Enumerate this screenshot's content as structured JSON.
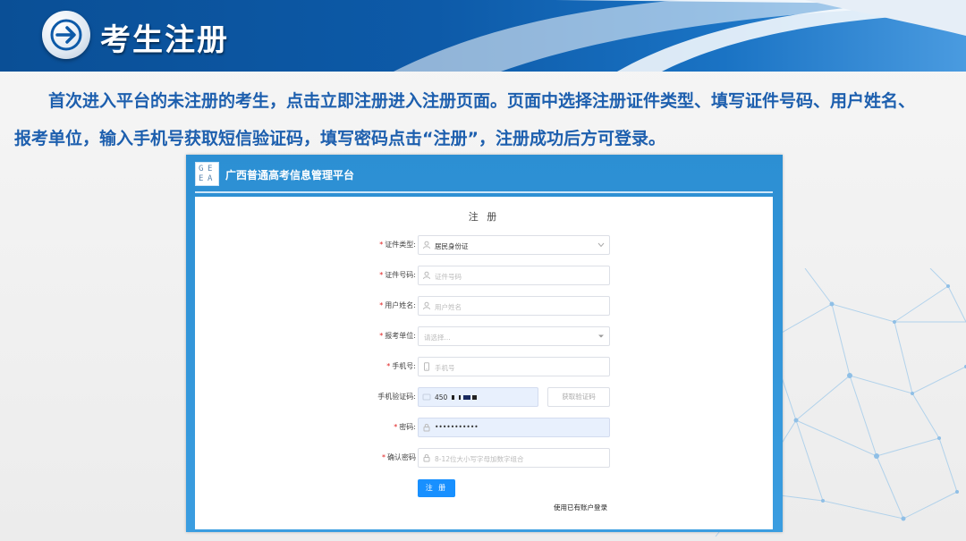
{
  "banner": {
    "title": "考生注册",
    "icon": "arrow-right-icon"
  },
  "intro": {
    "line1": "首次进入平台的未注册的考生，点击立即注册进入注册页面。页面中选择注册证件类型、填写证件号码、用户姓名、",
    "line2": "报考单位，输入手机号获取短信验证码，填写密码点击“注册”，注册成功后方可登录。"
  },
  "app": {
    "logo_letters": [
      "G",
      "E",
      "E",
      "A"
    ],
    "title": "广西普通高考信息管理平台",
    "form_title": "注 册",
    "fields": {
      "id_type": {
        "label": "证件类型:",
        "value": "居民身份证"
      },
      "id_number": {
        "label": "证件号码:",
        "placeholder": "证件号码"
      },
      "user_name": {
        "label": "用户姓名:",
        "placeholder": "用户姓名"
      },
      "unit": {
        "label": "报考单位:",
        "placeholder": "请选择..."
      },
      "phone": {
        "label": "手机号:",
        "placeholder": "手机号"
      },
      "sms_code": {
        "label": "手机验证码:",
        "value": "450"
      },
      "password": {
        "label": "密码:",
        "value": "•••••••••••"
      },
      "confirm_password": {
        "label": "确认密码",
        "placeholder": "8-12位大小写字母加数字组合"
      }
    },
    "required_mark": "*",
    "sms_button": "获取验证码",
    "submit_button": "注 册",
    "login_link": "使用已有账户登录"
  },
  "colors": {
    "banner": "#0d5aa8",
    "intro_text": "#1d5fae",
    "primary_button": "#1890ff",
    "app_bg": "#2c8fd3"
  }
}
